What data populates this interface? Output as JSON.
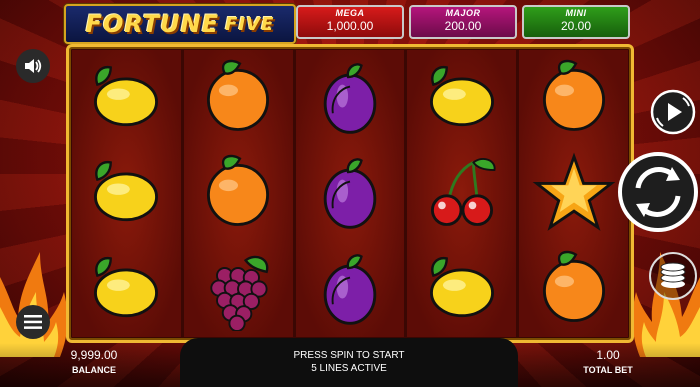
{
  "logo": {
    "word1": "FORTUNE",
    "word2": "FIVE"
  },
  "jackpots": [
    {
      "label": "MEGA",
      "value": "1,000.00",
      "color": "#c41616"
    },
    {
      "label": "MAJOR",
      "value": "200.00",
      "color": "#9c1269"
    },
    {
      "label": "MINI",
      "value": "20.00",
      "color": "#258714"
    }
  ],
  "reels": [
    [
      "lemon",
      "lemon",
      "lemon"
    ],
    [
      "orange",
      "orange",
      "grapes"
    ],
    [
      "plum",
      "plum",
      "plum"
    ],
    [
      "lemon",
      "cherry",
      "lemon"
    ],
    [
      "orange",
      "star",
      "orange"
    ]
  ],
  "controls": {
    "sound_icon": "speaker-icon",
    "menu_icon": "hamburger-icon",
    "autoplay_icon": "autoplay-icon",
    "spin_icon": "spin-arrows-icon",
    "bet_icon": "coin-stack-icon"
  },
  "footer": {
    "message_line1": "PRESS SPIN TO START",
    "message_line2": "5 LINES ACTIVE",
    "balance_value": "9,999.00",
    "balance_label": "BALANCE",
    "total_bet_value": "1.00",
    "total_bet_label": "TOTAL BET"
  }
}
